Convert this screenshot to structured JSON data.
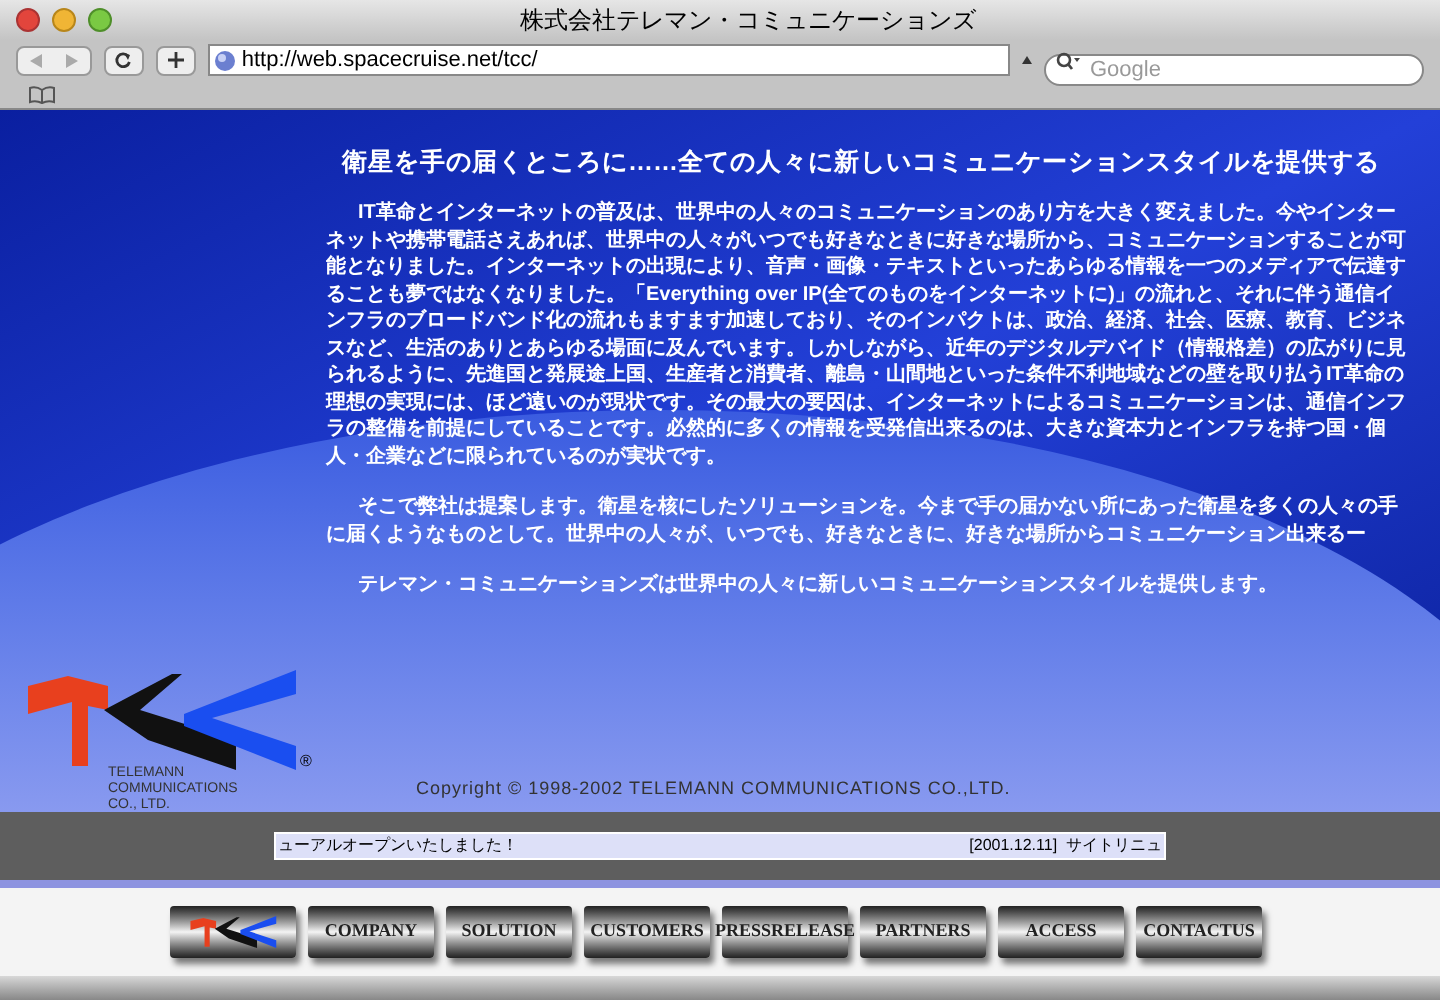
{
  "window": {
    "title": "株式会社テレマン・コミュニケーションズ"
  },
  "toolbar": {
    "url": "http://web.spacecruise.net/tcc/",
    "search_placeholder": "Google"
  },
  "page": {
    "headline": "衛星を手の届くところに……全ての人々に新しいコミュニケーションスタイルを提供する",
    "paragraphs": [
      "IT革命とインターネットの普及は、世界中の人々のコミュニケーションのあり方を大きく変えました。今やインターネットや携帯電話さえあれば、世界中の人々がいつでも好きなときに好きな場所から、コミュニケーションすることが可能となりました。インターネットの出現により、音声・画像・テキストといったあらゆる情報を一つのメディアで伝達することも夢ではなくなりました。「Everything over IP(全てのものをインターネットに)」の流れと、それに伴う通信インフラのブロードバンド化の流れもますます加速しており、そのインパクトは、政治、経済、社会、医療、教育、ビジネスなど、生活のありとあらゆる場面に及んでいます。しかしながら、近年のデジタルデバイド（情報格差）の広がりに見られるように、先進国と発展途上国、生産者と消費者、離島・山間地といった条件不利地域などの壁を取り払うIT革命の理想の実現には、ほど遠いのが現状です。その最大の要因は、インターネットによるコミュニケーションは、通信インフラの整備を前提にしていることです。必然的に多くの情報を受発信出来るのは、大きな資本力とインフラを持つ国・個人・企業などに限られているのが実状です。",
      "そこで弊社は提案します。衛星を核にしたソリューションを。今まで手の届かない所にあった衛星を多くの人々の手に届くようなものとして。世界中の人々が、いつでも、好きなときに、好きな場所からコミュニケーション出来るー",
      "テレマン・コミュニケーションズは世界中の人々に新しいコミュニケーションスタイルを提供します。"
    ],
    "logo_text": "TELEMANN COMMUNICATIONS CO., LTD.",
    "registered": "®",
    "copyright": "Copyright © 1998-2002 TELEMANN COMMUNICATIONS CO.,LTD."
  },
  "ticker": {
    "left": "ューアルオープンいたしました！",
    "right": "[2001.12.11]  サイトリニュ"
  },
  "nav": [
    {
      "kind": "logo"
    },
    {
      "kind": "text",
      "label": "COMPANY"
    },
    {
      "kind": "text",
      "label": "SOLUTION"
    },
    {
      "kind": "text",
      "label": "CUSTOMERS"
    },
    {
      "kind": "text",
      "label": "PRESSRELEASE"
    },
    {
      "kind": "text",
      "label": "PARTNERS"
    },
    {
      "kind": "text",
      "label": "ACCESS"
    },
    {
      "kind": "text",
      "label": "CONTACTUS"
    }
  ]
}
